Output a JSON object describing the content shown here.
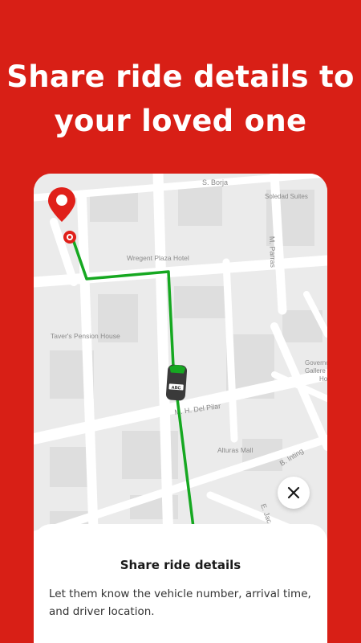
{
  "promo": {
    "headline_line1": "Share ride details to",
    "headline_line2": "your loved one"
  },
  "map": {
    "street_labels": [
      "S. Borja",
      "Soledad Suites",
      "M. Parras",
      "Wregent Plaza Hotel",
      "Taver's Pension House",
      "Governo",
      "Gallere",
      "Ho",
      "M. H. Del Pilar",
      "Alturas Mall",
      "B. Inting",
      "E. Jac",
      "Ro"
    ],
    "route_color": "#16a821",
    "pin_color": "#e0201a",
    "vehicle_icon": "car-icon",
    "vehicle_plate": "ABC"
  },
  "close_button": {
    "icon": "close-icon"
  },
  "sheet": {
    "title": "Share ride details",
    "description": "Let them know the vehicle number, arrival time, and driver location."
  },
  "colors": {
    "background": "#d81f16",
    "map_bg": "#ebebeb"
  }
}
